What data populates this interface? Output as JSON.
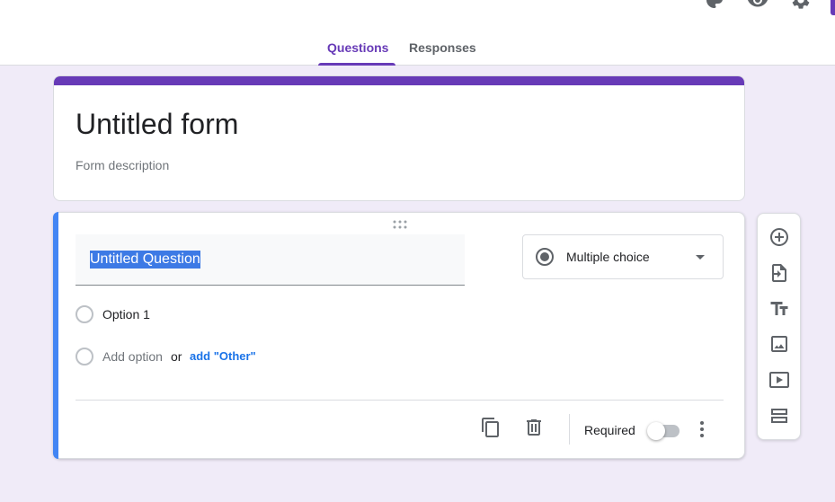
{
  "tabs": [
    {
      "label": "Questions",
      "active": true
    },
    {
      "label": "Responses",
      "active": false
    }
  ],
  "top_icons": [
    "palette-icon",
    "preview-eye-icon",
    "settings-gear-icon"
  ],
  "form": {
    "title": "Untitled form",
    "description_placeholder": "Form description"
  },
  "question": {
    "title": "Untitled Question",
    "type": "Multiple choice",
    "options": [
      "Option 1"
    ],
    "add_option_label": "Add option",
    "or_label": "or",
    "add_other_label": "add \"Other\"",
    "required_label": "Required",
    "required": false
  },
  "side_toolbar": [
    "add-question-icon",
    "import-questions-icon",
    "add-title-icon",
    "add-image-icon",
    "add-video-icon",
    "add-section-icon"
  ],
  "colors": {
    "accent": "#673ab7",
    "background": "#f0ebf8",
    "active_question": "#4285f4",
    "link": "#1a73e8"
  }
}
